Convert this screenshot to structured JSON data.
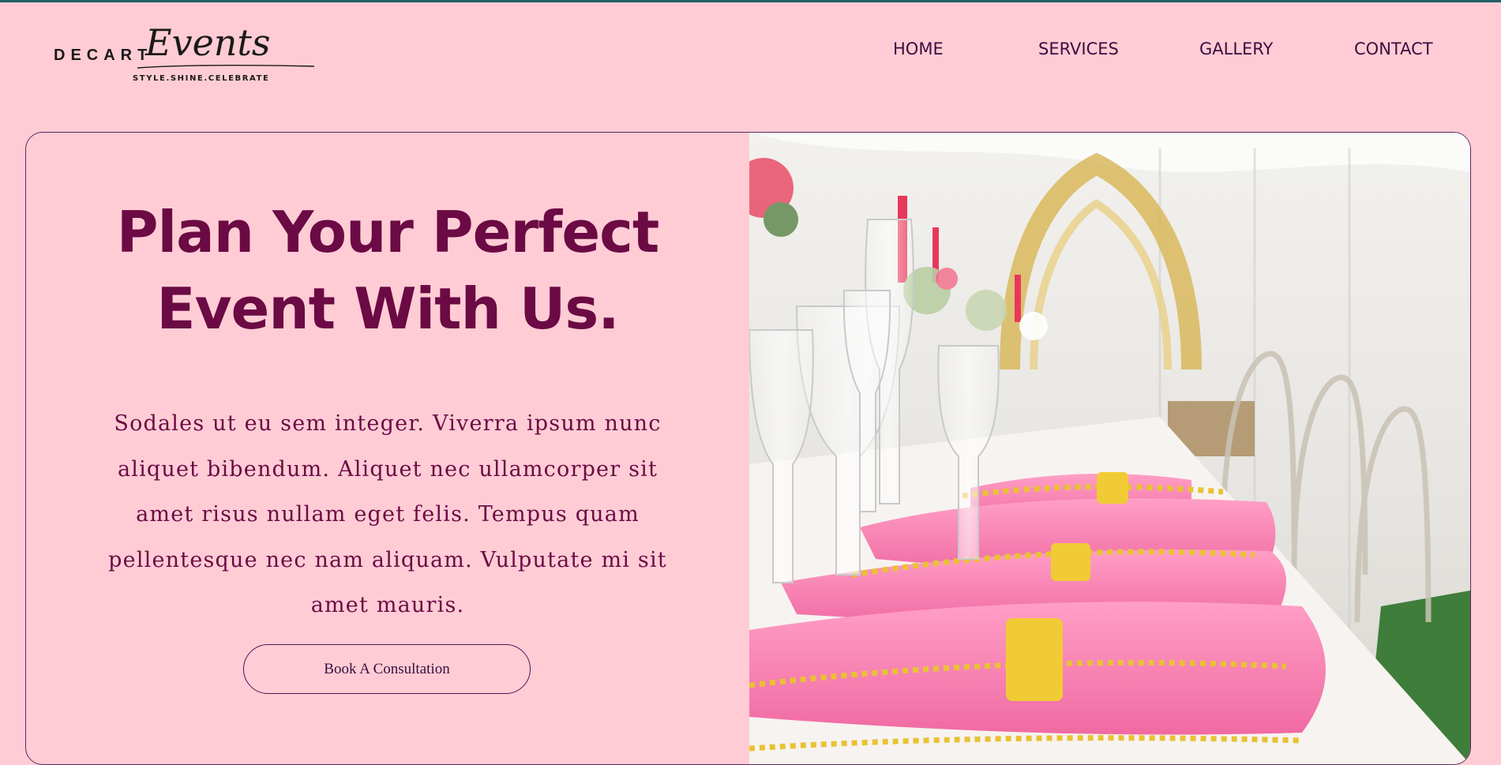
{
  "brand": {
    "wordmark": "DECART",
    "script": "Events",
    "tagline": "STYLE.SHINE.CELEBRATE"
  },
  "nav": {
    "items": [
      {
        "label": "HOME"
      },
      {
        "label": "SERVICES"
      },
      {
        "label": "GALLERY"
      },
      {
        "label": "CONTACT"
      }
    ]
  },
  "hero": {
    "title_line1": "Plan Your Perfect",
    "title_line2": "Event With Us.",
    "body": "Sodales ut eu sem integer. Viverra ipsum nunc aliquet bibendum. Aliquet nec ullamcorper sit amet risus nullam eget felis. Tempus quam pellentesque nec nam aliquam. Vulputate mi sit amet mauris.",
    "cta_label": "Book A Consultation",
    "photo": "decorated-banquet-table-photo"
  },
  "colors": {
    "background": "#ffccd5",
    "heading": "#6b0a44",
    "nav_text": "#3a0e3e",
    "top_bar": "#1f5f66"
  }
}
